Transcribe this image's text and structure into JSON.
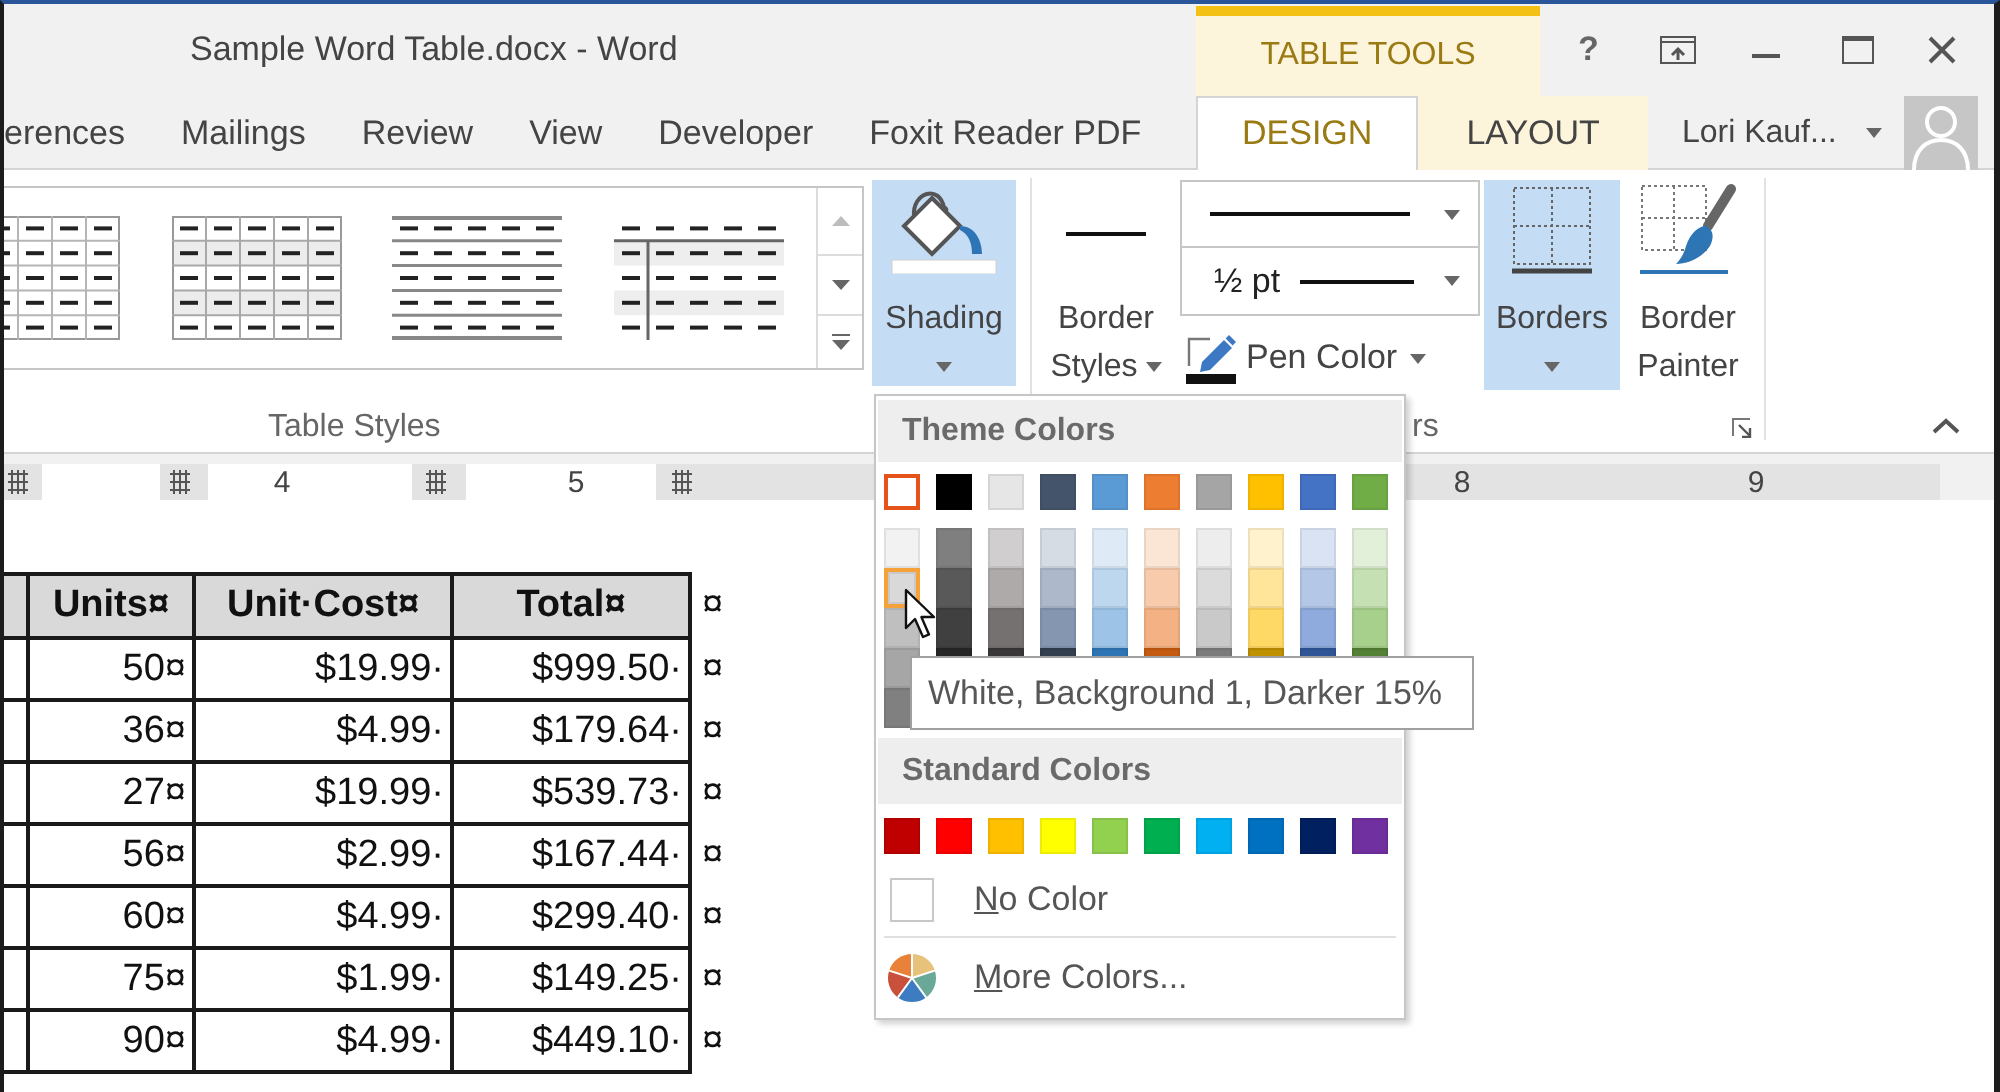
{
  "window": {
    "title": "Sample Word Table.docx - Word",
    "contextual_title": "TABLE TOOLS",
    "help": "?"
  },
  "tabs": [
    {
      "label": "erences",
      "kind": "normal",
      "selected": false
    },
    {
      "label": "Mailings",
      "kind": "normal",
      "selected": false
    },
    {
      "label": "Review",
      "kind": "normal",
      "selected": false
    },
    {
      "label": "View",
      "kind": "normal",
      "selected": false
    },
    {
      "label": "Developer",
      "kind": "normal",
      "selected": false
    },
    {
      "label": "Foxit Reader PDF",
      "kind": "normal",
      "selected": false
    },
    {
      "label": "DESIGN",
      "kind": "contextual",
      "selected": true
    },
    {
      "label": "LAYOUT",
      "kind": "contextual",
      "selected": false
    }
  ],
  "account": {
    "name": "Lori Kauf..."
  },
  "ribbon": {
    "table_styles": {
      "label": "Table Styles",
      "gallery": [
        {
          "kind": "grid",
          "cut_off": true
        },
        {
          "kind": "banded-grid",
          "cut_off": false
        },
        {
          "kind": "horizontal-lines",
          "cut_off": false
        },
        {
          "kind": "first-column",
          "cut_off": false
        }
      ]
    },
    "shading": {
      "label": "Shading",
      "highlighted": true
    },
    "borders_group": {
      "label": "rs",
      "border_styles": {
        "label": "Border Styles",
        "highlighted": false
      },
      "line_weight": {
        "value": "½ pt"
      },
      "pen_color": {
        "label": "Pen Color",
        "highlighted": false
      },
      "borders": {
        "label": "Borders",
        "highlighted": true
      },
      "border_painter": {
        "label": "Border Painter",
        "highlighted": false
      }
    }
  },
  "ruler": {
    "numbers": [
      "4",
      "5",
      "8",
      "9"
    ]
  },
  "table": {
    "cut_first_column": true,
    "header": {
      "cells": [
        "Units¤",
        "Unit·Cost¤",
        "Total¤"
      ],
      "end_mark": "¤"
    },
    "rows": [
      {
        "cells": [
          "50¤",
          "$19.99·",
          "$999.50·"
        ],
        "end_mark": "¤"
      },
      {
        "cells": [
          "36¤",
          "$4.99·",
          "$179.64·"
        ],
        "end_mark": "¤"
      },
      {
        "cells": [
          "27¤",
          "$19.99·",
          "$539.73·"
        ],
        "end_mark": "¤"
      },
      {
        "cells": [
          "56¤",
          "$2.99·",
          "$167.44·"
        ],
        "end_mark": "¤"
      },
      {
        "cells": [
          "60¤",
          "$4.99·",
          "$299.40·"
        ],
        "end_mark": "¤"
      },
      {
        "cells": [
          "75¤",
          "$1.99·",
          "$149.25·"
        ],
        "end_mark": "¤"
      },
      {
        "cells": [
          "90¤",
          "$4.99·",
          "$449.10·"
        ],
        "end_mark": "¤"
      }
    ]
  },
  "color_menu": {
    "theme_title": "Theme Colors",
    "theme_base": [
      {
        "color": "#ffffff",
        "selected": true,
        "hovered": false
      },
      {
        "color": "#000000",
        "selected": false,
        "hovered": false
      },
      {
        "color": "#e7e6e6",
        "selected": false,
        "hovered": false
      },
      {
        "color": "#44546a",
        "selected": false,
        "hovered": false
      },
      {
        "color": "#5b9bd5",
        "selected": false,
        "hovered": false
      },
      {
        "color": "#ed7d31",
        "selected": false,
        "hovered": false
      },
      {
        "color": "#a5a5a5",
        "selected": false,
        "hovered": false
      },
      {
        "color": "#ffc000",
        "selected": false,
        "hovered": false
      },
      {
        "color": "#4472c4",
        "selected": false,
        "hovered": false
      },
      {
        "color": "#70ad47",
        "selected": false,
        "hovered": false
      }
    ],
    "theme_shades": [
      [
        {
          "color": "#f2f2f2",
          "selected": false,
          "hovered": false
        },
        {
          "color": "#d9d9d9",
          "selected": false,
          "hovered": true
        },
        {
          "color": "#bfbfbf",
          "selected": false,
          "hovered": false
        },
        {
          "color": "#a6a6a6",
          "selected": false,
          "hovered": false
        },
        {
          "color": "#808080",
          "selected": false,
          "hovered": false
        }
      ],
      [
        {
          "color": "#7f7f7f",
          "selected": false,
          "hovered": false
        },
        {
          "color": "#595959",
          "selected": false,
          "hovered": false
        },
        {
          "color": "#404040",
          "selected": false,
          "hovered": false
        },
        {
          "color": "#262626",
          "selected": false,
          "hovered": false
        }
      ],
      [
        {
          "color": "#d0cece",
          "selected": false,
          "hovered": false
        },
        {
          "color": "#aeaaaa",
          "selected": false,
          "hovered": false
        },
        {
          "color": "#767171",
          "selected": false,
          "hovered": false
        },
        {
          "color": "#3a3838",
          "selected": false,
          "hovered": false
        }
      ],
      [
        {
          "color": "#d6dce4",
          "selected": false,
          "hovered": false
        },
        {
          "color": "#adb9ca",
          "selected": false,
          "hovered": false
        },
        {
          "color": "#8496b0",
          "selected": false,
          "hovered": false
        },
        {
          "color": "#333f4f",
          "selected": false,
          "hovered": false
        }
      ],
      [
        {
          "color": "#deebf6",
          "selected": false,
          "hovered": false
        },
        {
          "color": "#bdd7ee",
          "selected": false,
          "hovered": false
        },
        {
          "color": "#9dc3e6",
          "selected": false,
          "hovered": false
        },
        {
          "color": "#2e75b5",
          "selected": false,
          "hovered": false
        }
      ],
      [
        {
          "color": "#fbe5d5",
          "selected": false,
          "hovered": false
        },
        {
          "color": "#f7cbac",
          "selected": false,
          "hovered": false
        },
        {
          "color": "#f4b183",
          "selected": false,
          "hovered": false
        },
        {
          "color": "#c55a11",
          "selected": false,
          "hovered": false
        }
      ],
      [
        {
          "color": "#ededed",
          "selected": false,
          "hovered": false
        },
        {
          "color": "#dbdbdb",
          "selected": false,
          "hovered": false
        },
        {
          "color": "#c9c9c9",
          "selected": false,
          "hovered": false
        },
        {
          "color": "#7b7b7b",
          "selected": false,
          "hovered": false
        }
      ],
      [
        {
          "color": "#fff2cc",
          "selected": false,
          "hovered": false
        },
        {
          "color": "#ffe599",
          "selected": false,
          "hovered": false
        },
        {
          "color": "#ffd966",
          "selected": false,
          "hovered": false
        },
        {
          "color": "#bf9000",
          "selected": false,
          "hovered": false
        }
      ],
      [
        {
          "color": "#dae3f3",
          "selected": false,
          "hovered": false
        },
        {
          "color": "#b4c7e7",
          "selected": false,
          "hovered": false
        },
        {
          "color": "#8faadc",
          "selected": false,
          "hovered": false
        },
        {
          "color": "#2f5597",
          "selected": false,
          "hovered": false
        }
      ],
      [
        {
          "color": "#e2efd9",
          "selected": false,
          "hovered": false
        },
        {
          "color": "#c5e0b3",
          "selected": false,
          "hovered": false
        },
        {
          "color": "#a8d08d",
          "selected": false,
          "hovered": false
        },
        {
          "color": "#538135",
          "selected": false,
          "hovered": false
        }
      ]
    ],
    "standard_title": "Standard Colors",
    "standard": [
      {
        "color": "#c00000",
        "selected": false,
        "hovered": false
      },
      {
        "color": "#ff0000",
        "selected": false,
        "hovered": false
      },
      {
        "color": "#ffc000",
        "selected": false,
        "hovered": false
      },
      {
        "color": "#ffff00",
        "selected": false,
        "hovered": false
      },
      {
        "color": "#92d050",
        "selected": false,
        "hovered": false
      },
      {
        "color": "#00b050",
        "selected": false,
        "hovered": false
      },
      {
        "color": "#00b0f0",
        "selected": false,
        "hovered": false
      },
      {
        "color": "#0070c0",
        "selected": false,
        "hovered": false
      },
      {
        "color": "#002060",
        "selected": false,
        "hovered": false
      },
      {
        "color": "#7030a0",
        "selected": false,
        "hovered": false
      }
    ],
    "no_color": {
      "label": "No Color",
      "mnemonic": true
    },
    "more_colors": {
      "label": "More Colors...",
      "mnemonic": true
    }
  },
  "tooltip": {
    "text": "White, Background 1, Darker 15%"
  }
}
